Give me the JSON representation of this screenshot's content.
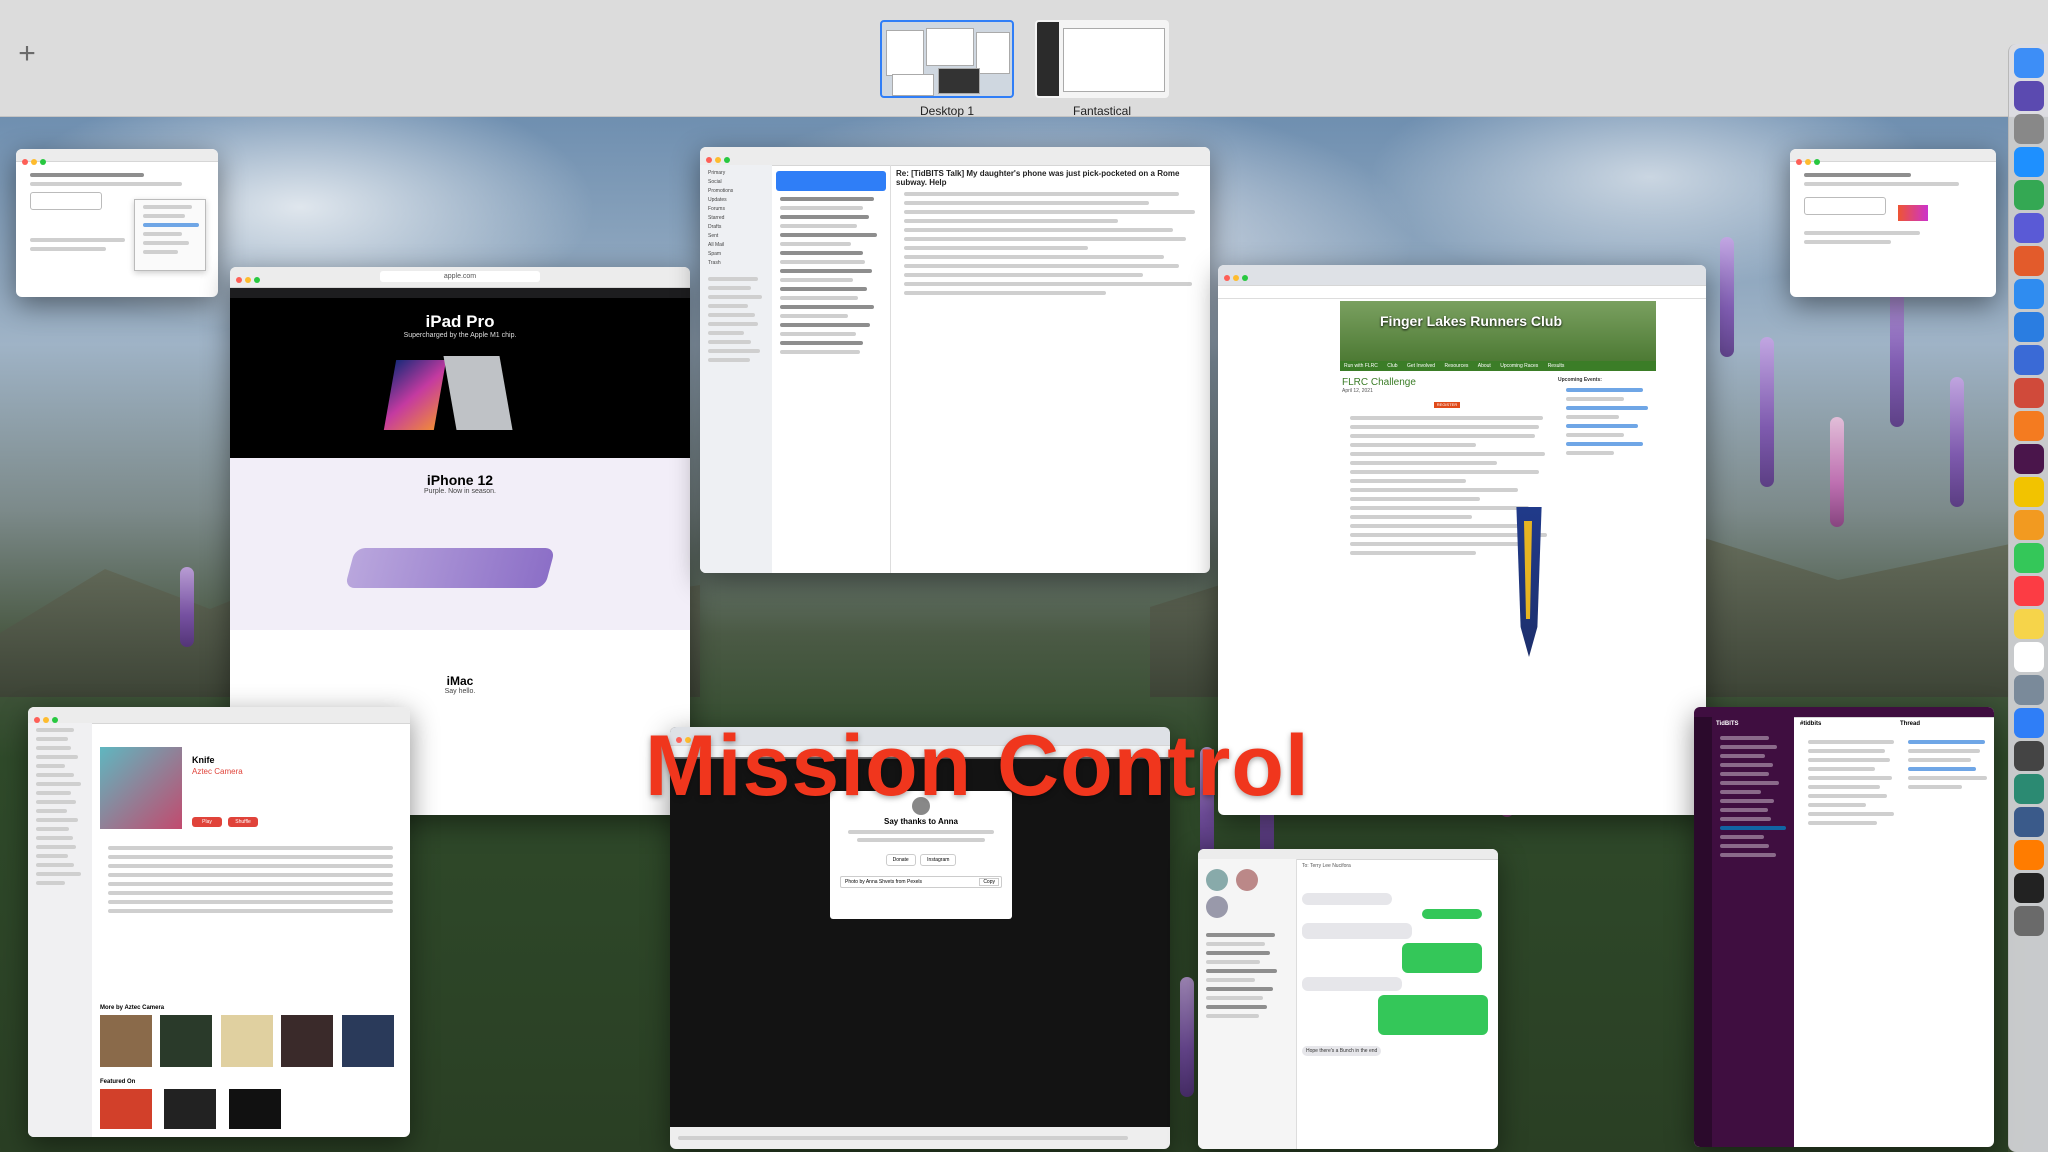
{
  "title": "Mission Control",
  "spaces": [
    {
      "label": "Desktop 1",
      "active": true
    },
    {
      "label": "Fantastical",
      "active": false
    }
  ],
  "safari_apple": {
    "url": "apple.com",
    "ipad_title": "iPad Pro",
    "ipad_sub": "Supercharged by the Apple M1 chip.",
    "iphone_title": "iPhone 12",
    "iphone_sub": "Purple. Now in season.",
    "imac_title": "iMac",
    "imac_sub": "Say hello."
  },
  "mail": {
    "mailboxes": [
      "Primary",
      "Social",
      "Promotions",
      "Updates",
      "Forums",
      "Starred",
      "Drafts",
      "Sent",
      "All Mail",
      "Spam",
      "Trash"
    ],
    "subject": "Re: [TidBITS Talk] My daughter's phone was just pick-pocketed on a Rome subway. Help"
  },
  "flrc": {
    "site_title": "Finger Lakes Runners Club",
    "page_title": "FLRC Challenge",
    "date": "April 12, 2021",
    "nav": [
      "Run with FLRC",
      "Club",
      "Get Involved",
      "Resources",
      "About",
      "Upcoming Races",
      "Results"
    ],
    "events_title": "Upcoming Events:",
    "register": "REGISTER"
  },
  "music": {
    "album": "Knife",
    "artist": "Aztec Camera",
    "more_by": "More by Aztec Camera",
    "featured": "Featured On",
    "play": "Play",
    "shuffle": "Shuffle"
  },
  "browser_dark": {
    "dialog_title": "Say thanks to Anna",
    "donate": "Donate",
    "instagram": "Instagram",
    "copy": "Copy",
    "credit": "Photo by Anna Shvets from Pexels"
  },
  "messages": {
    "contact": "To: Terry Lee Nucifora",
    "last": "Hope there's a Bunch in the end"
  },
  "slack": {
    "workspace": "TidBITS",
    "channel": "#tidbits",
    "thread": "Thread"
  },
  "colors": {
    "accent": "#2f7ef7",
    "title_red": "#f0361d",
    "flrc_green": "#3b7d27"
  }
}
